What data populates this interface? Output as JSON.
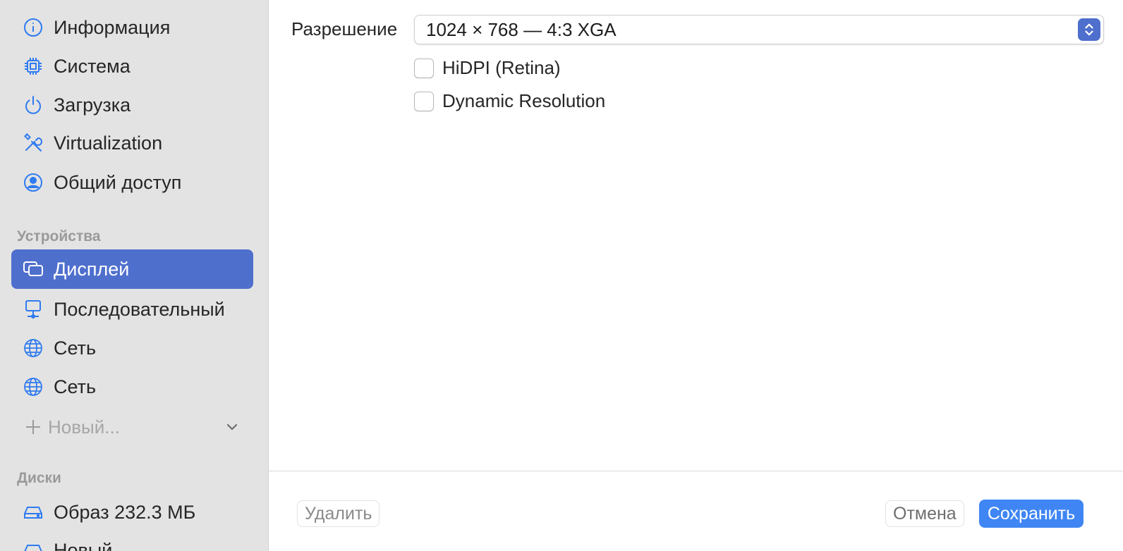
{
  "sidebar": {
    "items": [
      {
        "label": "Информация",
        "icon": "info-icon"
      },
      {
        "label": "Система",
        "icon": "cpu-chip-icon"
      },
      {
        "label": "Загрузка",
        "icon": "power-icon"
      },
      {
        "label": "Virtualization",
        "icon": "tools-icon"
      },
      {
        "label": "Общий доступ",
        "icon": "person-circle-icon"
      }
    ],
    "devices_header": "Устройства",
    "devices": [
      {
        "label": "Дисплей",
        "icon": "display-icon",
        "selected": true
      },
      {
        "label": "Последовательный",
        "icon": "serial-monitor-icon"
      },
      {
        "label": "Сеть",
        "icon": "globe-icon"
      },
      {
        "label": "Сеть",
        "icon": "globe-icon"
      }
    ],
    "new_label": "Новый...",
    "disks_header": "Диски",
    "disks": [
      {
        "label": "Образ 232.3 МБ",
        "icon": "drive-icon"
      },
      {
        "label": "Новый...",
        "icon": "drive-icon"
      }
    ]
  },
  "main": {
    "resolution_label": "Разрешение",
    "resolution_value": "1024 × 768 — 4:3 XGA",
    "hidpi_label": "HiDPI (Retina)",
    "dynamic_label": "Dynamic Resolution"
  },
  "footer": {
    "delete_label": "Удалить",
    "cancel_label": "Отмена",
    "save_label": "Сохранить"
  },
  "colors": {
    "accent": "#4f6fcd",
    "save_button": "#3f86f4",
    "icon_blue": "#2f7bf0",
    "sidebar_bg": "#e3e3e3"
  }
}
